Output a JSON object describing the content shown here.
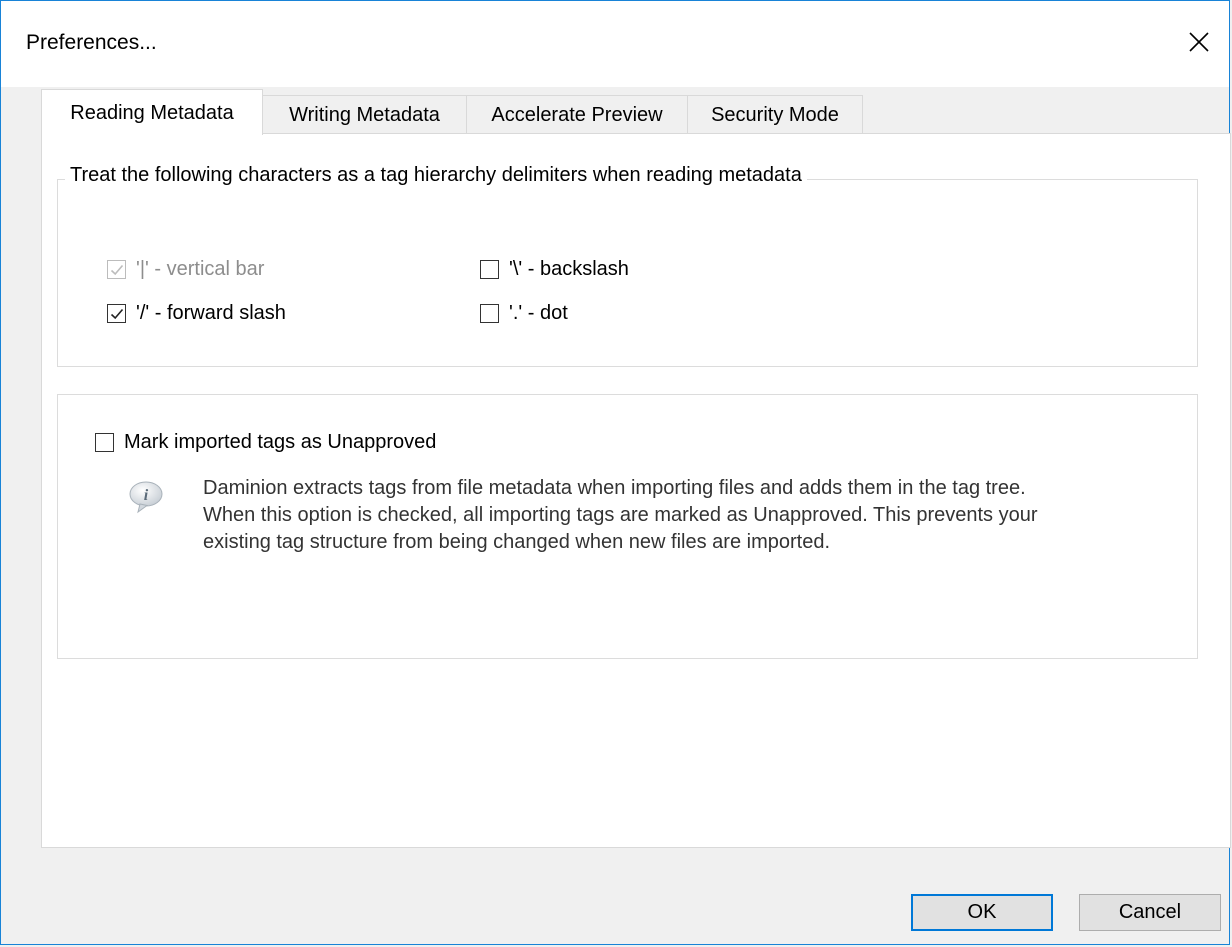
{
  "dialog": {
    "title": "Preferences...",
    "close_icon": "close-icon"
  },
  "tabs": [
    {
      "label": "Reading Metadata",
      "active": true
    },
    {
      "label": "Writing Metadata",
      "active": false
    },
    {
      "label": "Accelerate Preview",
      "active": false
    },
    {
      "label": "Security Mode",
      "active": false
    }
  ],
  "delimiters": {
    "legend": "Treat the following characters as a tag hierarchy delimiters when reading metadata",
    "options": [
      {
        "label": "'|' - vertical bar",
        "checked": true,
        "disabled": true
      },
      {
        "label": "'/' - forward slash",
        "checked": true,
        "disabled": false
      },
      {
        "label": "'\\' - backslash",
        "checked": false,
        "disabled": false
      },
      {
        "label": "'.' - dot",
        "checked": false,
        "disabled": false
      }
    ]
  },
  "unapproved": {
    "label": "Mark imported tags as Unapproved",
    "checked": false,
    "info_icon": "info-icon",
    "info_text": "Daminion extracts tags from file metadata when importing files and adds them in the tag tree. When this option is checked, all importing tags are marked as Unapproved. This prevents your existing tag structure from being changed when new files are imported."
  },
  "buttons": {
    "ok_label": "OK",
    "cancel_label": "Cancel"
  },
  "colors": {
    "accent": "#0078d7",
    "window_border": "#1883d7",
    "panel_background": "#ffffff",
    "dialog_background": "#f0f0f0"
  }
}
